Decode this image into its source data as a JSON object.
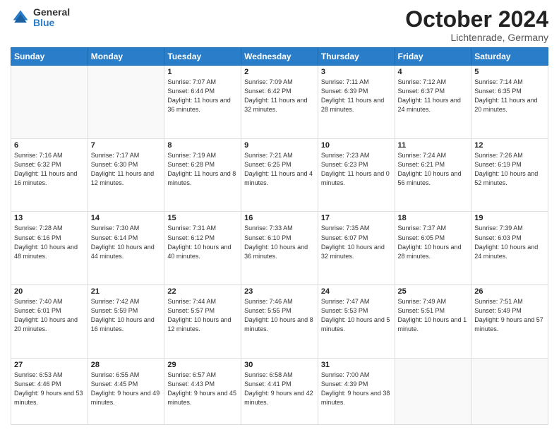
{
  "header": {
    "logo_general": "General",
    "logo_blue": "Blue",
    "title": "October 2024",
    "location": "Lichtenrade, Germany"
  },
  "weekdays": [
    "Sunday",
    "Monday",
    "Tuesday",
    "Wednesday",
    "Thursday",
    "Friday",
    "Saturday"
  ],
  "weeks": [
    [
      {
        "day": "",
        "detail": ""
      },
      {
        "day": "",
        "detail": ""
      },
      {
        "day": "1",
        "detail": "Sunrise: 7:07 AM\nSunset: 6:44 PM\nDaylight: 11 hours\nand 36 minutes."
      },
      {
        "day": "2",
        "detail": "Sunrise: 7:09 AM\nSunset: 6:42 PM\nDaylight: 11 hours\nand 32 minutes."
      },
      {
        "day": "3",
        "detail": "Sunrise: 7:11 AM\nSunset: 6:39 PM\nDaylight: 11 hours\nand 28 minutes."
      },
      {
        "day": "4",
        "detail": "Sunrise: 7:12 AM\nSunset: 6:37 PM\nDaylight: 11 hours\nand 24 minutes."
      },
      {
        "day": "5",
        "detail": "Sunrise: 7:14 AM\nSunset: 6:35 PM\nDaylight: 11 hours\nand 20 minutes."
      }
    ],
    [
      {
        "day": "6",
        "detail": "Sunrise: 7:16 AM\nSunset: 6:32 PM\nDaylight: 11 hours\nand 16 minutes."
      },
      {
        "day": "7",
        "detail": "Sunrise: 7:17 AM\nSunset: 6:30 PM\nDaylight: 11 hours\nand 12 minutes."
      },
      {
        "day": "8",
        "detail": "Sunrise: 7:19 AM\nSunset: 6:28 PM\nDaylight: 11 hours\nand 8 minutes."
      },
      {
        "day": "9",
        "detail": "Sunrise: 7:21 AM\nSunset: 6:25 PM\nDaylight: 11 hours\nand 4 minutes."
      },
      {
        "day": "10",
        "detail": "Sunrise: 7:23 AM\nSunset: 6:23 PM\nDaylight: 11 hours\nand 0 minutes."
      },
      {
        "day": "11",
        "detail": "Sunrise: 7:24 AM\nSunset: 6:21 PM\nDaylight: 10 hours\nand 56 minutes."
      },
      {
        "day": "12",
        "detail": "Sunrise: 7:26 AM\nSunset: 6:19 PM\nDaylight: 10 hours\nand 52 minutes."
      }
    ],
    [
      {
        "day": "13",
        "detail": "Sunrise: 7:28 AM\nSunset: 6:16 PM\nDaylight: 10 hours\nand 48 minutes."
      },
      {
        "day": "14",
        "detail": "Sunrise: 7:30 AM\nSunset: 6:14 PM\nDaylight: 10 hours\nand 44 minutes."
      },
      {
        "day": "15",
        "detail": "Sunrise: 7:31 AM\nSunset: 6:12 PM\nDaylight: 10 hours\nand 40 minutes."
      },
      {
        "day": "16",
        "detail": "Sunrise: 7:33 AM\nSunset: 6:10 PM\nDaylight: 10 hours\nand 36 minutes."
      },
      {
        "day": "17",
        "detail": "Sunrise: 7:35 AM\nSunset: 6:07 PM\nDaylight: 10 hours\nand 32 minutes."
      },
      {
        "day": "18",
        "detail": "Sunrise: 7:37 AM\nSunset: 6:05 PM\nDaylight: 10 hours\nand 28 minutes."
      },
      {
        "day": "19",
        "detail": "Sunrise: 7:39 AM\nSunset: 6:03 PM\nDaylight: 10 hours\nand 24 minutes."
      }
    ],
    [
      {
        "day": "20",
        "detail": "Sunrise: 7:40 AM\nSunset: 6:01 PM\nDaylight: 10 hours\nand 20 minutes."
      },
      {
        "day": "21",
        "detail": "Sunrise: 7:42 AM\nSunset: 5:59 PM\nDaylight: 10 hours\nand 16 minutes."
      },
      {
        "day": "22",
        "detail": "Sunrise: 7:44 AM\nSunset: 5:57 PM\nDaylight: 10 hours\nand 12 minutes."
      },
      {
        "day": "23",
        "detail": "Sunrise: 7:46 AM\nSunset: 5:55 PM\nDaylight: 10 hours\nand 8 minutes."
      },
      {
        "day": "24",
        "detail": "Sunrise: 7:47 AM\nSunset: 5:53 PM\nDaylight: 10 hours\nand 5 minutes."
      },
      {
        "day": "25",
        "detail": "Sunrise: 7:49 AM\nSunset: 5:51 PM\nDaylight: 10 hours\nand 1 minute."
      },
      {
        "day": "26",
        "detail": "Sunrise: 7:51 AM\nSunset: 5:49 PM\nDaylight: 9 hours\nand 57 minutes."
      }
    ],
    [
      {
        "day": "27",
        "detail": "Sunrise: 6:53 AM\nSunset: 4:46 PM\nDaylight: 9 hours\nand 53 minutes."
      },
      {
        "day": "28",
        "detail": "Sunrise: 6:55 AM\nSunset: 4:45 PM\nDaylight: 9 hours\nand 49 minutes."
      },
      {
        "day": "29",
        "detail": "Sunrise: 6:57 AM\nSunset: 4:43 PM\nDaylight: 9 hours\nand 45 minutes."
      },
      {
        "day": "30",
        "detail": "Sunrise: 6:58 AM\nSunset: 4:41 PM\nDaylight: 9 hours\nand 42 minutes."
      },
      {
        "day": "31",
        "detail": "Sunrise: 7:00 AM\nSunset: 4:39 PM\nDaylight: 9 hours\nand 38 minutes."
      },
      {
        "day": "",
        "detail": ""
      },
      {
        "day": "",
        "detail": ""
      }
    ]
  ]
}
